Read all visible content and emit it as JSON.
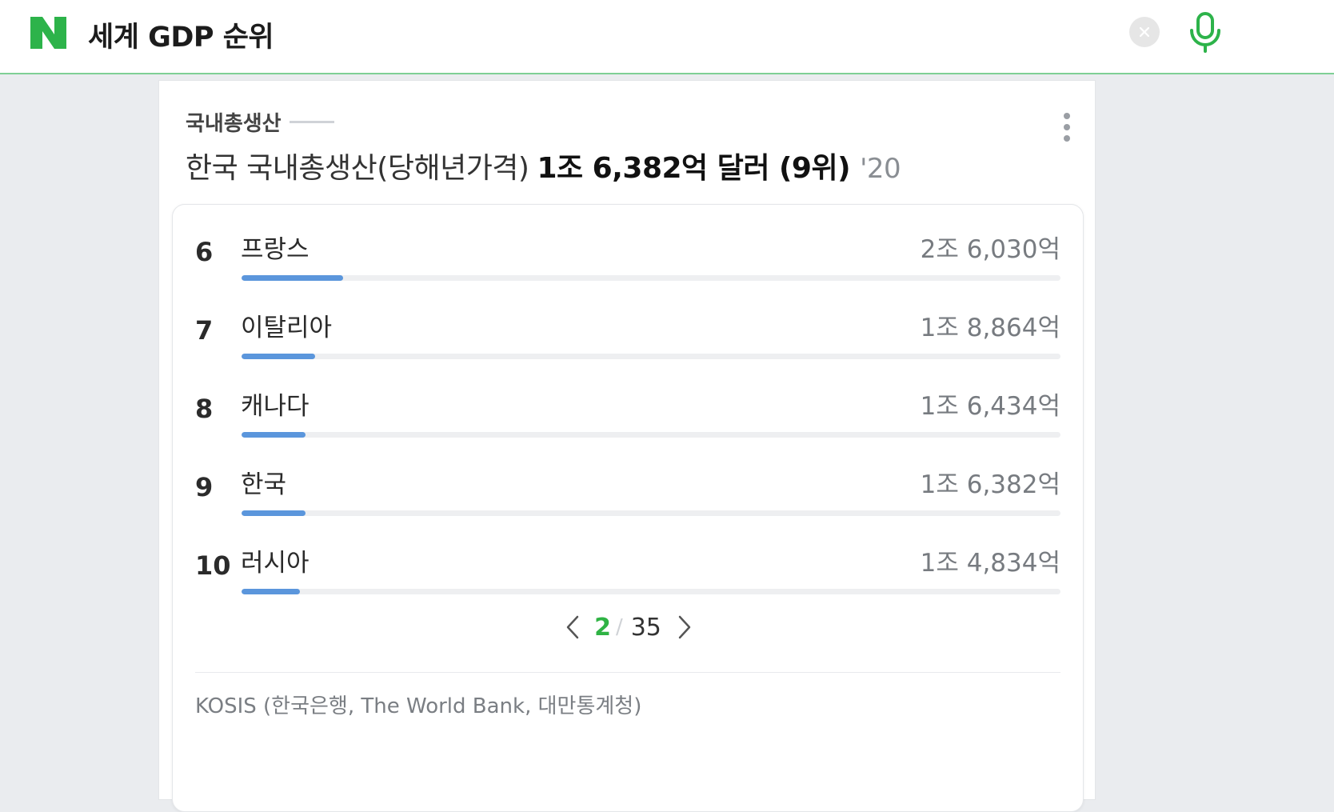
{
  "header": {
    "logo_letter": "N",
    "query": "세계 GDP 순위",
    "clear_label": "×"
  },
  "card": {
    "section_label": "국내총생산",
    "headline": {
      "prefix": "한국 국내총생산(당해년가격)",
      "value": "1조 6,382억 달러 (9위)",
      "year": "'20"
    },
    "rows": [
      {
        "rank": "6",
        "country": "프랑스",
        "value": "2조 6,030억",
        "bar": 0.124
      },
      {
        "rank": "7",
        "country": "이탈리아",
        "value": "1조 8,864억",
        "bar": 0.09
      },
      {
        "rank": "8",
        "country": "캐나다",
        "value": "1조 6,434억",
        "bar": 0.078
      },
      {
        "rank": "9",
        "country": "한국",
        "value": "1조 6,382억",
        "bar": 0.078
      },
      {
        "rank": "10",
        "country": "러시아",
        "value": "1조 4,834억",
        "bar": 0.071
      }
    ],
    "pagination": {
      "current": "2",
      "separator": "/",
      "total": "35"
    },
    "source": "KOSIS (한국은행, The World Bank, 대만통계청)"
  },
  "colors": {
    "brand_green": "#2db34a",
    "bar_blue": "#5b96dc",
    "accent_green_line": "#7fcf95"
  }
}
